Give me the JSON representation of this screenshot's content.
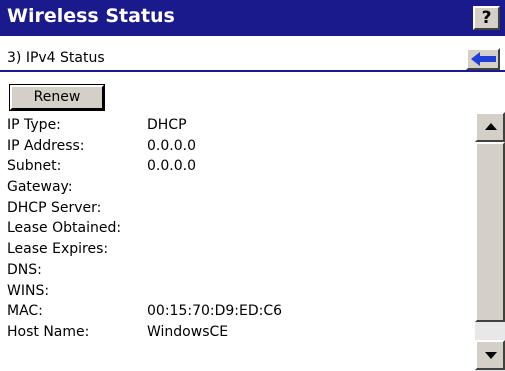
{
  "window": {
    "title": "Wireless Status",
    "help_label": "?"
  },
  "subheader": {
    "title": "3) IPv4 Status",
    "back_icon": "arrow-left-icon"
  },
  "toolbar": {
    "renew_label": "Renew"
  },
  "fields": [
    {
      "label": "IP Type:",
      "value": "DHCP"
    },
    {
      "label": "IP Address:",
      "value": "0.0.0.0"
    },
    {
      "label": "Subnet:",
      "value": "0.0.0.0"
    },
    {
      "label": "Gateway:",
      "value": ""
    },
    {
      "label": "DHCP Server:",
      "value": ""
    },
    {
      "label": "Lease Obtained:",
      "value": ""
    },
    {
      "label": "Lease Expires:",
      "value": ""
    },
    {
      "label": "DNS:",
      "value": ""
    },
    {
      "label": "WINS:",
      "value": ""
    },
    {
      "label": "MAC:",
      "value": "00:15:70:D9:ED:C6"
    },
    {
      "label": "Host Name:",
      "value": "WindowsCE"
    }
  ],
  "colors": {
    "titlebar": "#1a1a8c",
    "back_arrow": "#1f3fd8"
  }
}
